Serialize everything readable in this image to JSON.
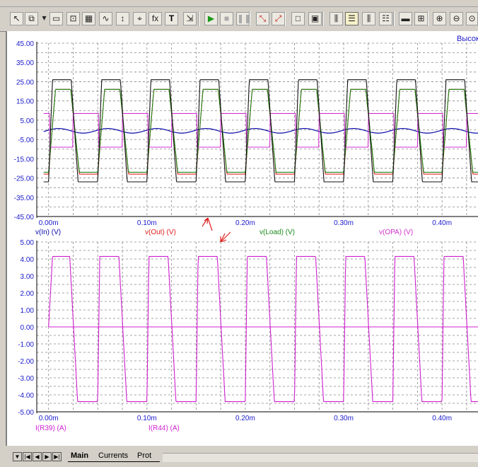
{
  "toolbar": {
    "icons": [
      "pointer-icon",
      "copy-icon",
      "dropdown-icon",
      "window-icon",
      "zoom-to-fit-icon",
      "grid-icon",
      "curve-icon",
      "cursor-icon",
      "marker-icon",
      "formula-icon",
      "text-icon",
      "export-icon",
      "run-icon",
      "stop-icon",
      "pause-icon",
      "diagram-red-icon",
      "diagram-red2-icon",
      "frame-icon",
      "frame2-icon",
      "layout-1-icon",
      "layout-2-icon",
      "layout-3-icon",
      "layout-4-icon",
      "hgrid-icon",
      "hgrid2-icon",
      "zoom-in-icon",
      "zoom-out-icon",
      "zoom-fit-icon"
    ]
  },
  "top_right_label": "Высок",
  "chart_data": [
    {
      "type": "line",
      "title": "",
      "xlabel": "",
      "ylabel": "",
      "xlim": [
        -0.012,
        0.438
      ],
      "ylim": [
        -45,
        45
      ],
      "grid": true,
      "y_ticks": [
        "45.00",
        "35.00",
        "25.00",
        "15.00",
        "5.00",
        "-5.00",
        "-15.00",
        "-25.00",
        "-35.00",
        "-45.00"
      ],
      "x_ticks": [
        "0.00m",
        "0.10m",
        "0.20m",
        "0.30m",
        "0.40m"
      ],
      "x_unit": "ms",
      "period": 0.05,
      "series": [
        {
          "name": "v(In) (V)",
          "color": "#0a0aa8",
          "waveform": "sine",
          "amplitude": 1.2,
          "offset": -0.5
        },
        {
          "name": "v(Out) (V)",
          "color": "#e02020",
          "waveform": "clipped-triangle",
          "high": 21,
          "low": -23
        },
        {
          "name": "v(Load) (V)",
          "color": "#1a8a1a",
          "waveform": "clipped-triangle",
          "high": 21,
          "low": -22
        },
        {
          "name": "v(OPA) (V)",
          "color": "#d030d0",
          "waveform": "square",
          "high": 8.5,
          "low": -9
        },
        {
          "name": "",
          "color": "#111111",
          "waveform": "trapezoid",
          "high": 26,
          "low": -27
        }
      ]
    },
    {
      "type": "line",
      "title": "",
      "xlabel": "",
      "ylabel": "",
      "xlim": [
        -0.012,
        0.438
      ],
      "ylim": [
        -5,
        5
      ],
      "grid": true,
      "y_ticks": [
        "5.00",
        "4.00",
        "3.00",
        "2.00",
        "1.00",
        "0.00",
        "-1.00",
        "-2.00",
        "-3.00",
        "-4.00",
        "-5.00"
      ],
      "x_ticks": [
        "0.00m",
        "0.10m",
        "0.20m",
        "0.30m",
        "0.40m"
      ],
      "x_unit": "ms",
      "period": 0.05,
      "series": [
        {
          "name": "I(R39) (A)",
          "color": "#d020d0",
          "waveform": "trapezoid",
          "high": 4.15,
          "low": -4.4
        },
        {
          "name": "I(R44) (A)",
          "color": "#d020d0",
          "waveform": "flat",
          "value": 0
        }
      ]
    }
  ],
  "tabs": [
    "Main",
    "Currents",
    "Prot"
  ]
}
